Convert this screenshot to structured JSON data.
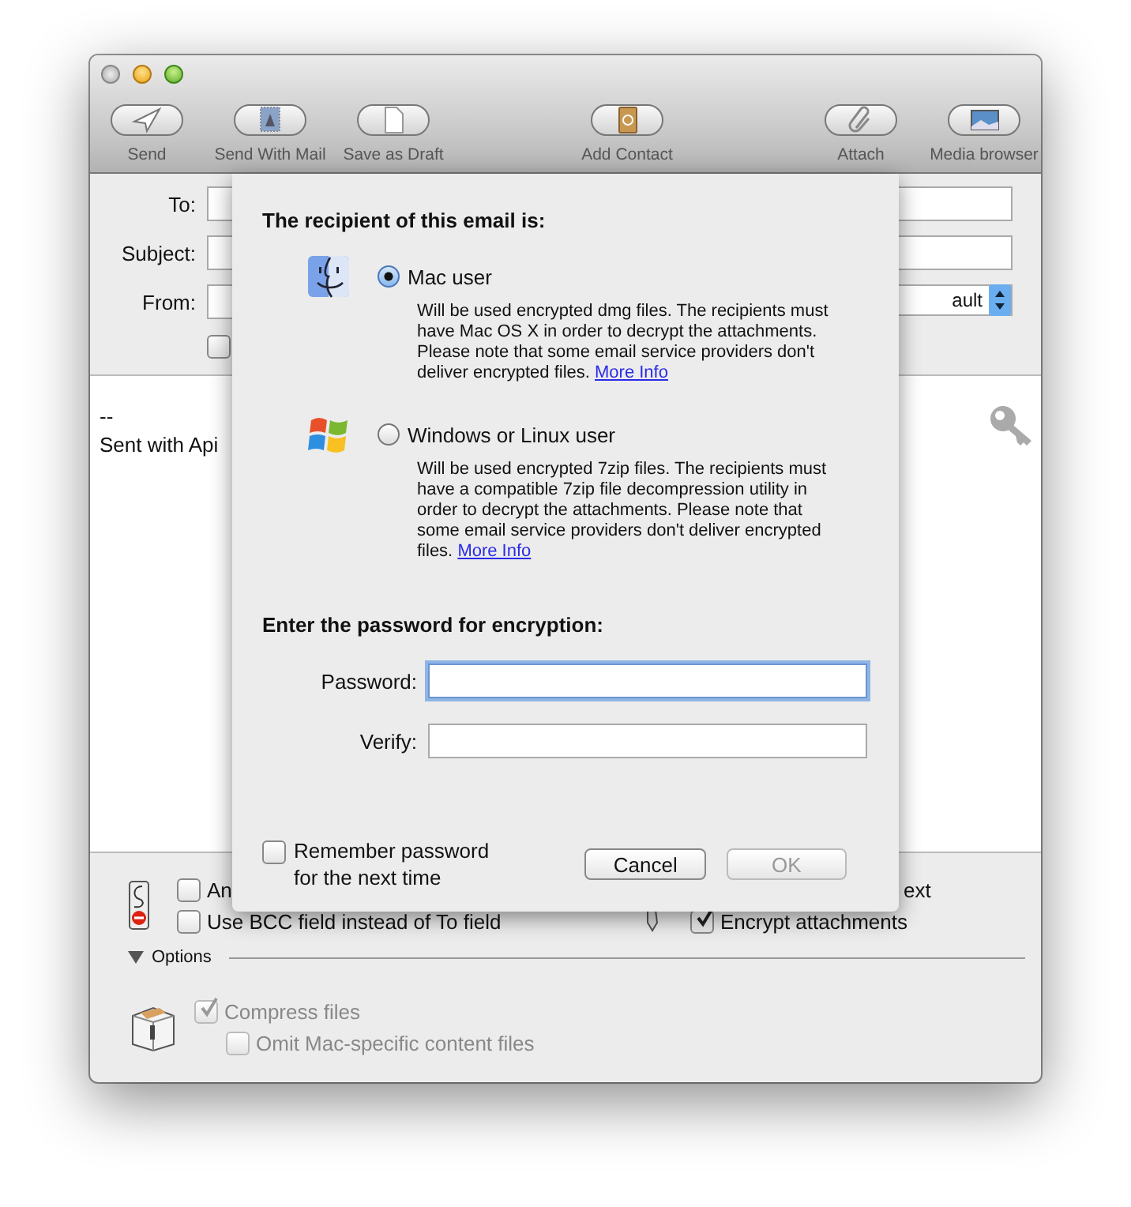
{
  "toolbar": [
    {
      "label": "Send"
    },
    {
      "label": "Send With Mail"
    },
    {
      "label": "Save as Draft"
    },
    {
      "label": "Add Contact"
    },
    {
      "label": "Attach"
    },
    {
      "label": "Media browser"
    }
  ],
  "header": {
    "fields": [
      {
        "label": "To:"
      },
      {
        "label": "Subject:"
      },
      {
        "label": "From:"
      }
    ],
    "signature_value": "ault",
    "bcc_copy": {
      "checked": false
    }
  },
  "body": {
    "lines": [
      "--",
      "Sent with Api"
    ]
  },
  "attachment_options": [
    {
      "label": "An",
      "checked": false
    },
    {
      "label": "Use BCC field instead of To field",
      "checked": false
    }
  ],
  "encryption_options": [
    {
      "kind": "text",
      "label": "ext"
    },
    {
      "kind": "checkbox",
      "label": "Encrypt attachments",
      "checked": true
    }
  ],
  "options_section": {
    "label": "Options",
    "expanded": true,
    "items": [
      {
        "label": "Compress files",
        "checked": true,
        "disabled": true,
        "children": [
          {
            "label": "Omit Mac-specific content files",
            "checked": false,
            "disabled": true
          }
        ]
      }
    ]
  },
  "sheet": {
    "title": "The recipient of this email is:",
    "choices": [
      {
        "label": "Mac user",
        "selected": true,
        "description": "Will be used encrypted dmg files. The recipients must have Mac OS X in order to decrypt the attachments. Please note that some email service providers don't deliver encrypted files.",
        "link": "More Info"
      },
      {
        "label": "Windows or Linux user",
        "selected": false,
        "description": "Will be used encrypted 7zip files. The recipients must have a compatible 7zip file decompression utility in order to decrypt the attachments. Please note that some email service providers don't deliver encrypted files.",
        "link": "More Info"
      }
    ],
    "password_heading": "Enter the password for encryption:",
    "fields": [
      {
        "label": "Password:",
        "focused": true
      },
      {
        "label": "Verify:",
        "focused": false
      }
    ],
    "remember": {
      "label": "Remember password for the next time",
      "checked": false
    },
    "buttons": [
      {
        "label": "Cancel",
        "disabled": false
      },
      {
        "label": "OK",
        "disabled": true
      }
    ]
  }
}
